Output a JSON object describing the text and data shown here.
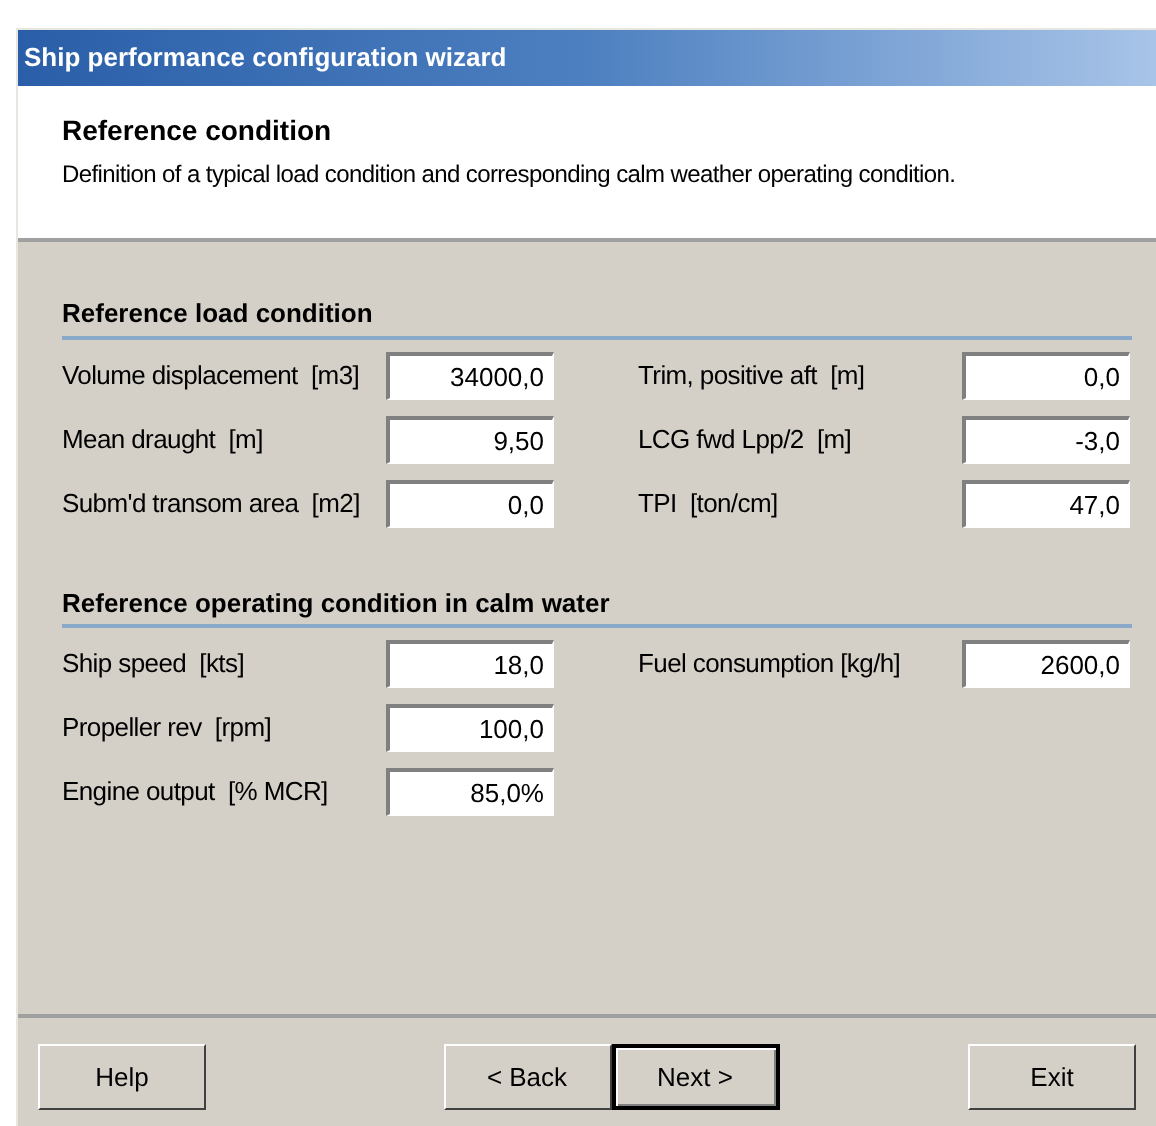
{
  "window": {
    "title": "Ship performance configuration wizard"
  },
  "header": {
    "title": "Reference condition",
    "description": "Definition of a typical load condition and corresponding calm weather operating condition."
  },
  "sections": [
    {
      "title": "Reference load condition",
      "rows": [
        {
          "left": {
            "label": "Volume displacement  [m3]",
            "value": "34000,0"
          },
          "right": {
            "label": "Trim, positive aft  [m]",
            "value": "0,0"
          }
        },
        {
          "left": {
            "label": "Mean draught  [m]",
            "value": "9,50"
          },
          "right": {
            "label": "LCG fwd Lpp/2  [m]",
            "value": "-3,0"
          }
        },
        {
          "left": {
            "label": "Subm'd transom area  [m2]",
            "value": "0,0"
          },
          "right": {
            "label": "TPI  [ton/cm]",
            "value": "47,0"
          }
        }
      ]
    },
    {
      "title": "Reference operating condition in calm water",
      "rows": [
        {
          "left": {
            "label": "Ship speed  [kts]",
            "value": "18,0"
          },
          "right": {
            "label": "Fuel consumption [kg/h]",
            "value": "2600,0"
          }
        },
        {
          "left": {
            "label": "Propeller rev  [rpm]",
            "value": "100,0"
          }
        },
        {
          "left": {
            "label": "Engine output  [% MCR]",
            "value": "85,0%"
          }
        }
      ]
    }
  ],
  "button_bar": {
    "left": [
      {
        "label": "Help",
        "default": false
      }
    ],
    "center": [
      {
        "label": "< Back",
        "default": false
      },
      {
        "label": "Next >",
        "default": true
      }
    ],
    "right": [
      {
        "label": "Exit",
        "default": false
      }
    ]
  }
}
